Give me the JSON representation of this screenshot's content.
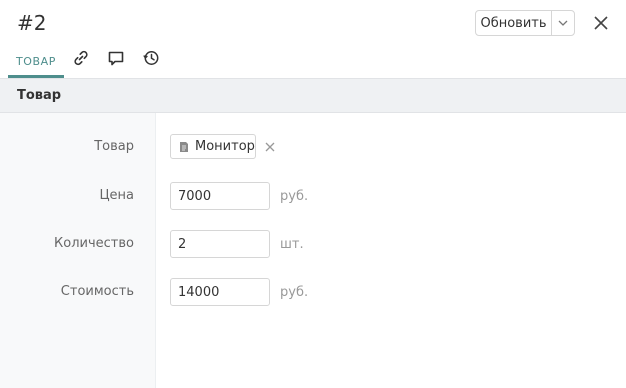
{
  "header": {
    "title": "#2",
    "update_label": "Обновить"
  },
  "tabs": {
    "active_label": "ТОВАР",
    "icons": [
      "link-icon",
      "comment-icon",
      "history-icon"
    ]
  },
  "section": {
    "title": "Товар"
  },
  "form": {
    "product": {
      "label": "Товар",
      "value": "Монитор"
    },
    "price": {
      "label": "Цена",
      "value": "7000",
      "unit": "руб."
    },
    "quantity": {
      "label": "Количество",
      "value": "2",
      "unit": "шт."
    },
    "cost": {
      "label": "Стоимость",
      "value": "14000",
      "unit": "руб."
    }
  },
  "colors": {
    "accent": "#4e8e8c",
    "section_bg": "#eff1f3",
    "left_pane_bg": "#f8f9fa",
    "border": "#d6d6d6"
  }
}
